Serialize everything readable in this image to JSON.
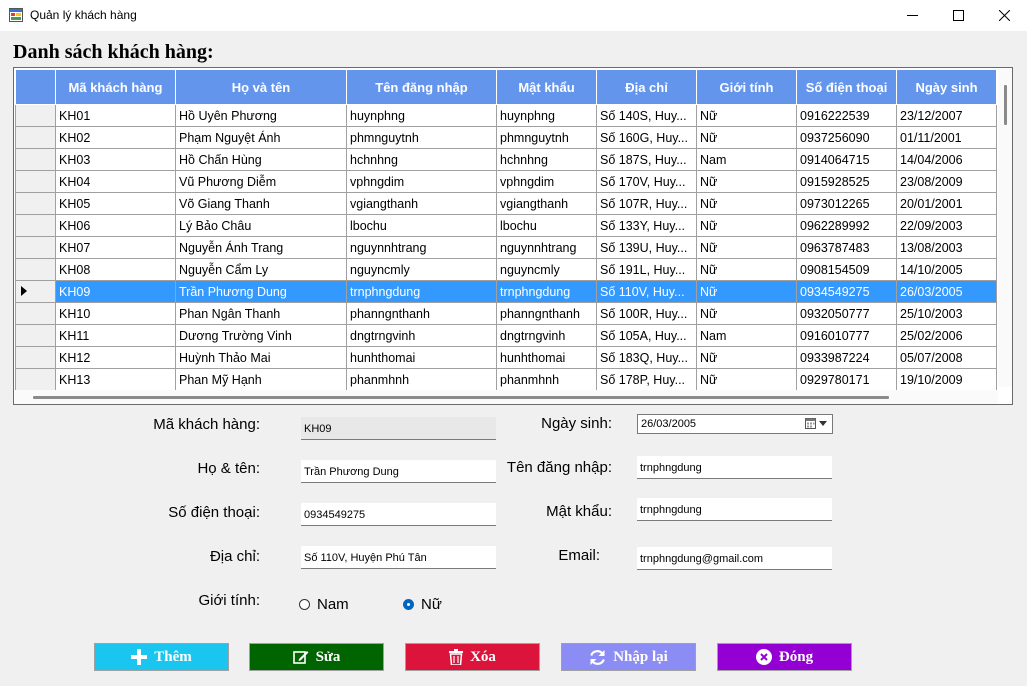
{
  "window": {
    "title": "Quản lý khách hàng"
  },
  "heading": "Danh sách khách hàng:",
  "grid": {
    "columns": [
      "Mã khách hàng",
      "Họ và tên",
      "Tên đăng nhập",
      "Mật khẩu",
      "Địa chỉ",
      "Giới tính",
      "Số điện thoại",
      "Ngày sinh"
    ],
    "rows": [
      [
        "KH01",
        "Hồ Uyên Phương",
        "huynphng",
        "huynphng",
        "Số 140S, Huy...",
        "Nữ",
        "0916222539",
        "23/12/2007"
      ],
      [
        "KH02",
        "Phạm Nguyệt Ánh",
        "phmnguytnh",
        "phmnguytnh",
        "Số 160G, Huy...",
        "Nữ",
        "0937256090",
        "01/11/2001"
      ],
      [
        "KH03",
        "Hồ Chấn Hùng",
        "hchnhng",
        "hchnhng",
        "Số 187S, Huy...",
        "Nam",
        "0914064715",
        "14/04/2006"
      ],
      [
        "KH04",
        "Vũ Phương Diễm",
        "vphngdim",
        "vphngdim",
        "Số 170V, Huy...",
        "Nữ",
        "0915928525",
        "23/08/2009"
      ],
      [
        "KH05",
        "Võ Giang Thanh",
        "vgiangthanh",
        "vgiangthanh",
        "Số 107R, Huy...",
        "Nữ",
        "0973012265",
        "20/01/2001"
      ],
      [
        "KH06",
        "Lý Bảo Châu",
        "lbochu",
        "lbochu",
        "Số 133Y, Huy...",
        "Nữ",
        "0962289992",
        "22/09/2003"
      ],
      [
        "KH07",
        "Nguyễn Ánh Trang",
        "nguynnhtrang",
        "nguynnhtrang",
        "Số 139U, Huy...",
        "Nữ",
        "0963787483",
        "13/08/2003"
      ],
      [
        "KH08",
        "Nguyễn Cẩm Ly",
        "nguyncmly",
        "nguyncmly",
        "Số 191L, Huy...",
        "Nữ",
        "0908154509",
        "14/10/2005"
      ],
      [
        "KH09",
        "Trần Phương Dung",
        "trnphngdung",
        "trnphngdung",
        "Số 110V, Huy...",
        "Nữ",
        "0934549275",
        "26/03/2005"
      ],
      [
        "KH10",
        "Phan Ngân Thanh",
        "phanngnthanh",
        "phanngnthanh",
        "Số 100R, Huy...",
        "Nữ",
        "0932050777",
        "25/10/2003"
      ],
      [
        "KH11",
        "Dương Trường Vinh",
        "dngtrngvinh",
        "dngtrngvinh",
        "Số 105A, Huy...",
        "Nam",
        "0916010777",
        "25/02/2006"
      ],
      [
        "KH12",
        "Huỳnh Thảo Mai",
        "hunhthomai",
        "hunhthomai",
        "Số 183Q, Huy...",
        "Nữ",
        "0933987224",
        "05/07/2008"
      ],
      [
        "KH13",
        "Phan Mỹ Hạnh",
        "phanmhnh",
        "phanmhnh",
        "Số 178P, Huy...",
        "Nữ",
        "0929780171",
        "19/10/2009"
      ]
    ],
    "selected_index": 8
  },
  "form": {
    "ma_kh": {
      "label": "Mã khách hàng:",
      "value": "KH09"
    },
    "ho_ten": {
      "label": "Họ & tên:",
      "value": "Trần Phương Dung"
    },
    "sdt": {
      "label": "Số điện thoại:",
      "value": "0934549275"
    },
    "dia_chi": {
      "label": "Địa chỉ:",
      "value": "Số 110V, Huyện Phú Tân"
    },
    "gioi_tinh": {
      "label": "Giới tính:",
      "options": [
        "Nam",
        "Nữ"
      ],
      "selected": "Nữ"
    },
    "ngay_sinh": {
      "label": "Ngày sinh:",
      "value": "26/03/2005"
    },
    "ten_dang_nhap": {
      "label": "Tên đăng nhập:",
      "value": "trnphngdung"
    },
    "mat_khau": {
      "label": "Mật khẩu:",
      "value": "trnphngdung"
    },
    "email": {
      "label": "Email:",
      "value": "trnphngdung@gmail.com"
    }
  },
  "buttons": {
    "them": {
      "label": "Thêm",
      "color": "#1ac6f0",
      "icon": "plus-icon"
    },
    "sua": {
      "label": "Sửa",
      "color": "#006400",
      "icon": "edit-icon"
    },
    "xoa": {
      "label": "Xóa",
      "color": "#dc143c",
      "icon": "trash-icon"
    },
    "nhap_lai": {
      "label": "Nhập lại",
      "color": "#8c8cf5",
      "icon": "refresh-icon"
    },
    "dong": {
      "label": "Đóng",
      "color": "#9400d3",
      "icon": "close-circle-icon"
    }
  },
  "colors": {
    "header": "#6495ed",
    "selection": "#3399ff"
  }
}
